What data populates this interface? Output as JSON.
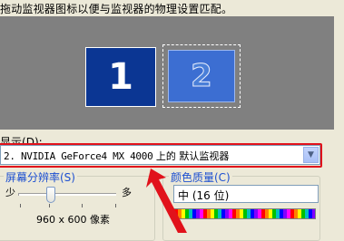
{
  "instruction": "拖动监视器图标以便与监视器的物理设置匹配。",
  "monitors": [
    {
      "number": "1"
    },
    {
      "number": "2"
    }
  ],
  "display_label_text": "显示(",
  "display_label_key": "D",
  "display_label_end": "):",
  "display_select": {
    "value_latin": "2. NVIDIA GeForce4 MX 4000",
    "value_cn": " 上的 默认监视器"
  },
  "resolution": {
    "legend": "屏幕分辨率(S)",
    "less_label": "少",
    "more_label": "多",
    "value_text": "960 x 600 像素",
    "slider_fraction": 0.33
  },
  "color_quality": {
    "legend": "颜色质量(C)",
    "value": "中 (16 位)"
  },
  "colors": {
    "highlight": "#e1121b",
    "monitor1": "#0b3693",
    "monitor2": "#3c6ed2"
  }
}
